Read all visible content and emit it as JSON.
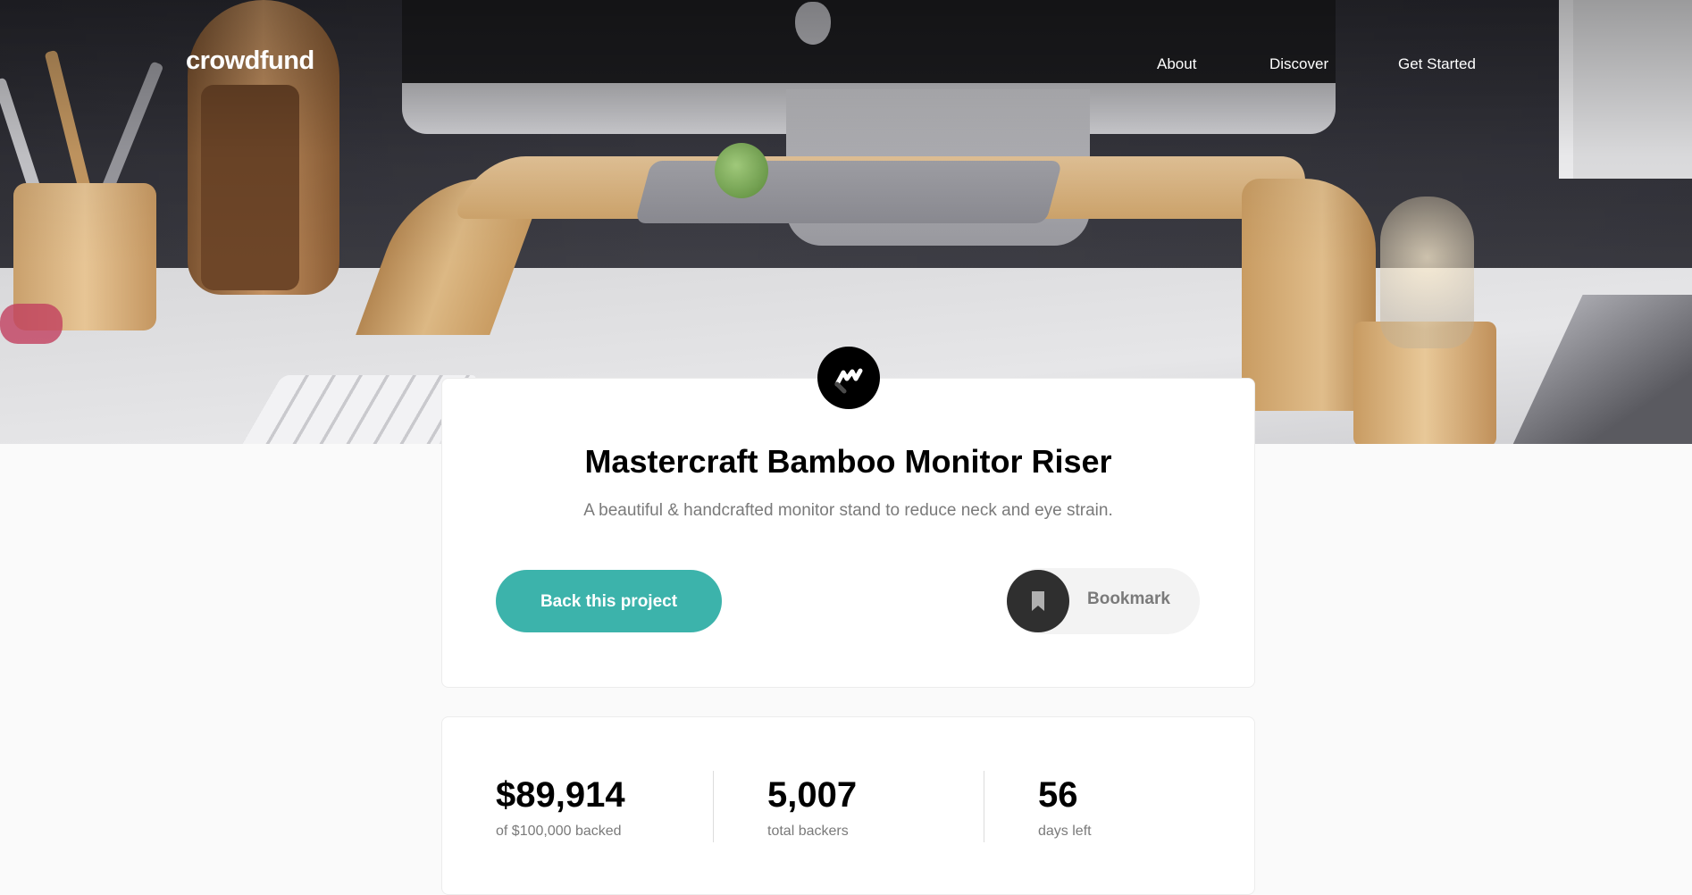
{
  "header": {
    "logo": "crowdfund",
    "nav": [
      {
        "label": "About"
      },
      {
        "label": "Discover"
      },
      {
        "label": "Get Started"
      }
    ]
  },
  "project": {
    "brand_icon": "mastercraft-logo-icon",
    "title": "Mastercraft Bamboo Monitor Riser",
    "description": "A beautiful & handcrafted monitor stand to reduce neck and eye strain.",
    "back_button_label": "Back this project",
    "bookmark_label": "Bookmark",
    "bookmark_icon": "bookmark-icon"
  },
  "stats": [
    {
      "value": "$89,914",
      "label": "of $100,000 backed"
    },
    {
      "value": "5,007",
      "label": "total backers"
    },
    {
      "value": "56",
      "label": "days left"
    }
  ],
  "colors": {
    "accent": "#3cb3ab",
    "dark": "#2f2f2f",
    "muted_text": "#7a7a7a",
    "background": "#fafafa"
  }
}
